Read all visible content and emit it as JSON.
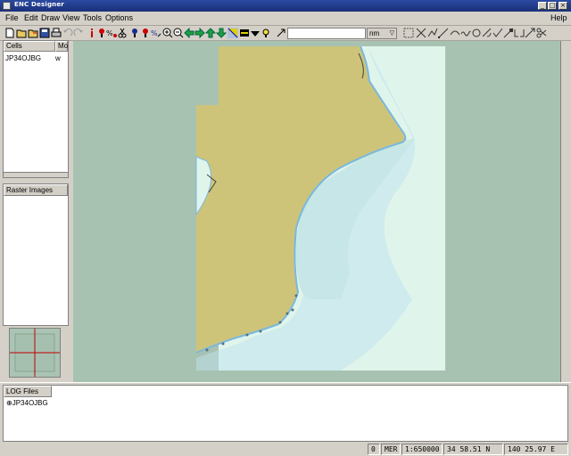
{
  "window": {
    "title": "ENC Designer",
    "controls": [
      "minimize",
      "maximize",
      "close"
    ]
  },
  "menu": {
    "items": [
      "File",
      "Edit",
      "Draw",
      "View",
      "Tools",
      "Options"
    ],
    "help": "Help"
  },
  "toolbar": {
    "scale_value": "",
    "unit": "nm"
  },
  "cells_panel": {
    "columns": [
      "Cells",
      "Mo"
    ],
    "rows": [
      {
        "name": "JP34OJBG",
        "mode": "w"
      }
    ]
  },
  "raster_panel": {
    "header": "Raster Images"
  },
  "log_panel": {
    "header": "LOG Files",
    "entries": [
      "JP34OJBG"
    ]
  },
  "statusbar": {
    "count": "0",
    "projection": "MER",
    "scale": "1:650000",
    "latitude": "34 58.51 N",
    "longitude": "140 25.97 E"
  },
  "colors": {
    "land": "#cdc47a",
    "sea_deep": "#aac4b4",
    "sea_shallow": "#dff5ec",
    "shoreline_blue": "#8ec8e8",
    "window_bg": "#d4d0c8"
  }
}
